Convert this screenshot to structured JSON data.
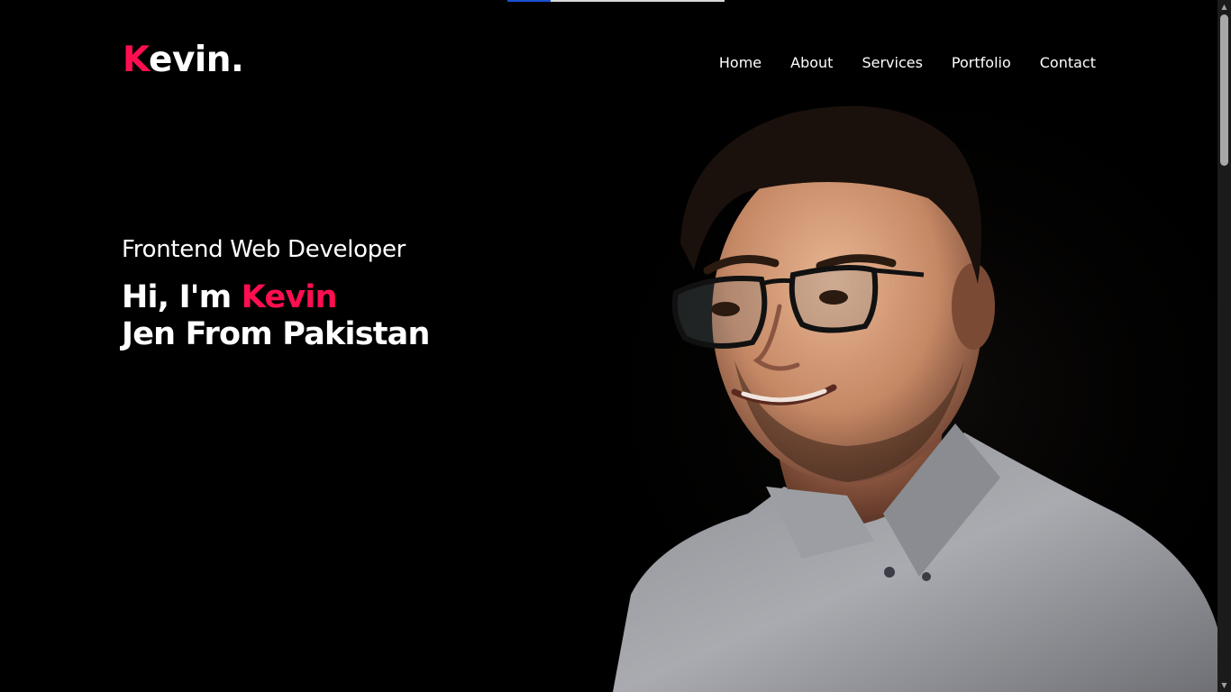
{
  "page_progress": 0.2,
  "logo": {
    "first_letter": "K",
    "rest": "evin."
  },
  "nav": {
    "items": [
      {
        "label": "Home"
      },
      {
        "label": "About"
      },
      {
        "label": "Services"
      },
      {
        "label": "Portfolio"
      },
      {
        "label": "Contact"
      }
    ]
  },
  "hero": {
    "subtitle": "Frontend Web Developer",
    "greeting_prefix": "Hi, I'm ",
    "greeting_name": "Kevin",
    "line2": "Jen From Pakistan"
  },
  "colors": {
    "accent": "#ff0f50",
    "background": "#000000",
    "text": "#ffffff"
  },
  "icons": {
    "scroll_up": "triangle-up",
    "scroll_down": "triangle-down"
  }
}
